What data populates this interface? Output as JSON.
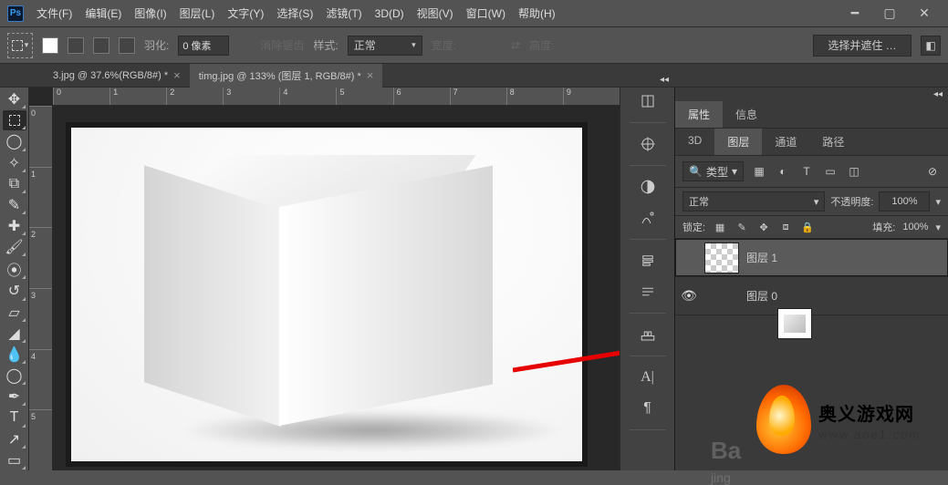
{
  "menu": {
    "items": [
      "文件(F)",
      "编辑(E)",
      "图像(I)",
      "图层(L)",
      "文字(Y)",
      "选择(S)",
      "滤镜(T)",
      "3D(D)",
      "视图(V)",
      "窗口(W)",
      "帮助(H)"
    ]
  },
  "optionsbar": {
    "feather_label": "羽化:",
    "feather_value": "0 像素",
    "antialias": "消除锯齿",
    "style_label": "样式:",
    "style_value": "正常",
    "width_label": "宽度:",
    "height_label": "高度:",
    "select_mask": "选择并遮住 …"
  },
  "tabs": [
    {
      "label": "3.jpg @ 37.6%(RGB/8#) *",
      "active": false
    },
    {
      "label": "timg.jpg @ 133% (图层 1, RGB/8#) *",
      "active": true
    }
  ],
  "ruler_h": [
    "0",
    "1",
    "2",
    "3",
    "4",
    "5",
    "6",
    "7",
    "8",
    "9"
  ],
  "ruler_v": [
    "0",
    "1",
    "2",
    "3",
    "4",
    "5"
  ],
  "panel": {
    "top_tabs": [
      "属性",
      "信息"
    ],
    "layer_tabs": [
      "3D",
      "图层",
      "通道",
      "路径"
    ],
    "filter_label": "类型",
    "blend": "正常",
    "opacity_label": "不透明度:",
    "opacity": "100%",
    "lock_label": "锁定:",
    "fill_label": "填充:",
    "fill": "100%"
  },
  "layers": [
    {
      "name": "图层 1",
      "visible": false,
      "selected": true,
      "thumb": "trans"
    },
    {
      "name": "图层 0",
      "visible": true,
      "selected": false,
      "thumb": "cube"
    }
  ],
  "watermark": {
    "title": "奥义游戏网",
    "url": "www.aoe1.com",
    "baidu": "Ba",
    "jing": "jing"
  }
}
